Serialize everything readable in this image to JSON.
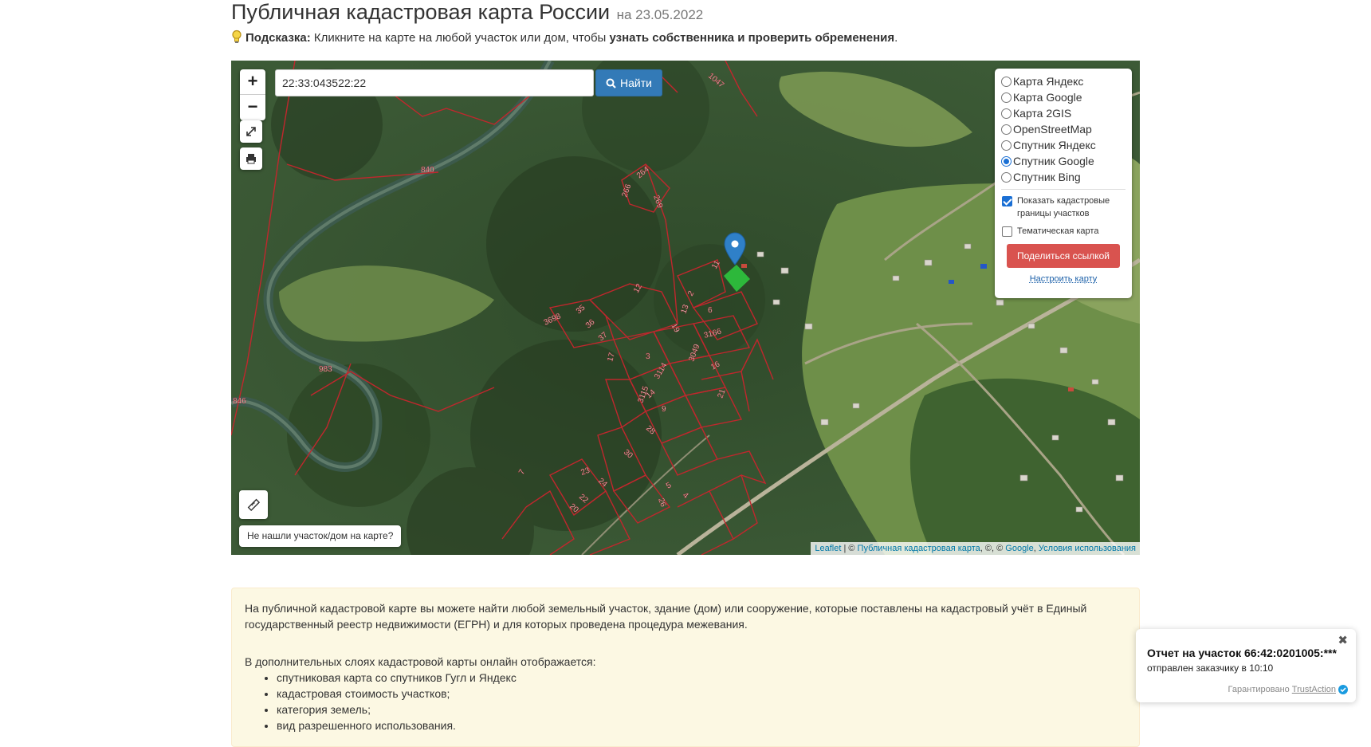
{
  "header": {
    "title": "Публичная кадастровая карта России",
    "date": "на 23.05.2022"
  },
  "hint": {
    "label": "Подсказка:",
    "text": " Кликните на карте на любой участок или дом, чтобы ",
    "bold": "узнать собственника и проверить обременения",
    "end": "."
  },
  "search": {
    "value": "22:33:043522:22",
    "button": "Найти"
  },
  "zoom": {
    "in": "+",
    "out": "−"
  },
  "layers": {
    "options": [
      {
        "label": "Карта Яндекс",
        "selected": false
      },
      {
        "label": "Карта Google",
        "selected": false
      },
      {
        "label": "Карта 2GIS",
        "selected": false
      },
      {
        "label": "OpenStreetMap",
        "selected": false
      },
      {
        "label": "Спутник Яндекс",
        "selected": false
      },
      {
        "label": "Спутник Google",
        "selected": true
      },
      {
        "label": "Спутник Bing",
        "selected": false
      }
    ],
    "show_borders": {
      "label": "Показать кадастровые границы участков",
      "checked": true
    },
    "thematic": {
      "label": "Тематическая карта",
      "checked": false
    },
    "share": "Поделиться ссылкой",
    "configure": "Настроить карту"
  },
  "map": {
    "not_found": "Не нашли участок/дом на карте?",
    "parcel_labels": [
      "1047",
      "840",
      "983",
      "846",
      "264",
      "266",
      "269",
      "3698",
      "35",
      "36",
      "37",
      "11",
      "12",
      "13",
      "3166",
      "3049",
      "3114",
      "3115",
      "14",
      "19",
      "28",
      "30",
      "17",
      "23",
      "22",
      "24",
      "26",
      "20",
      "4",
      "5",
      "7",
      "16",
      "21",
      "2",
      "3",
      "6",
      "9"
    ],
    "attribution": {
      "leaflet": "Leaflet",
      "sep1": " | © ",
      "pkk": "Публичная кадастровая карта",
      "mid": ", ©, © ",
      "google": "Google",
      "comma": ", ",
      "terms": "Условия использования"
    }
  },
  "info": {
    "p1": "На публичной кадастровой карте вы можете найти любой земельный участок, здание (дом) или сооружение, которые поставлены на кадастровый учёт в Единый государственный реестр недвижимости (ЕГРН) и для которых проведена процедура межевания.",
    "p2": "В дополнительных слоях кадастровой карты онлайн отображается:",
    "items": [
      "спутниковая карта со спутников Гугл и Яндекс",
      "кадастровая стоимость участков;",
      "категория земель;",
      "вид разрешенного использования."
    ]
  },
  "toast": {
    "title": "Отчет на участок 66:42:0201005:***",
    "subtitle": "отправлен заказчику в 10:10",
    "guarantee": "Гарантировано",
    "brand": "TrustAction"
  },
  "colors": {
    "primary": "#337ab7",
    "danger": "#d9534f",
    "parcel_border": "#c0272d",
    "marker": "#2f80c8",
    "selected_parcel": "#2ecc40"
  },
  "icons": [
    "lightbulb-icon",
    "fullscreen-icon",
    "print-icon",
    "search-icon",
    "ruler-icon",
    "map-marker-icon",
    "close-icon",
    "verified-icon"
  ]
}
